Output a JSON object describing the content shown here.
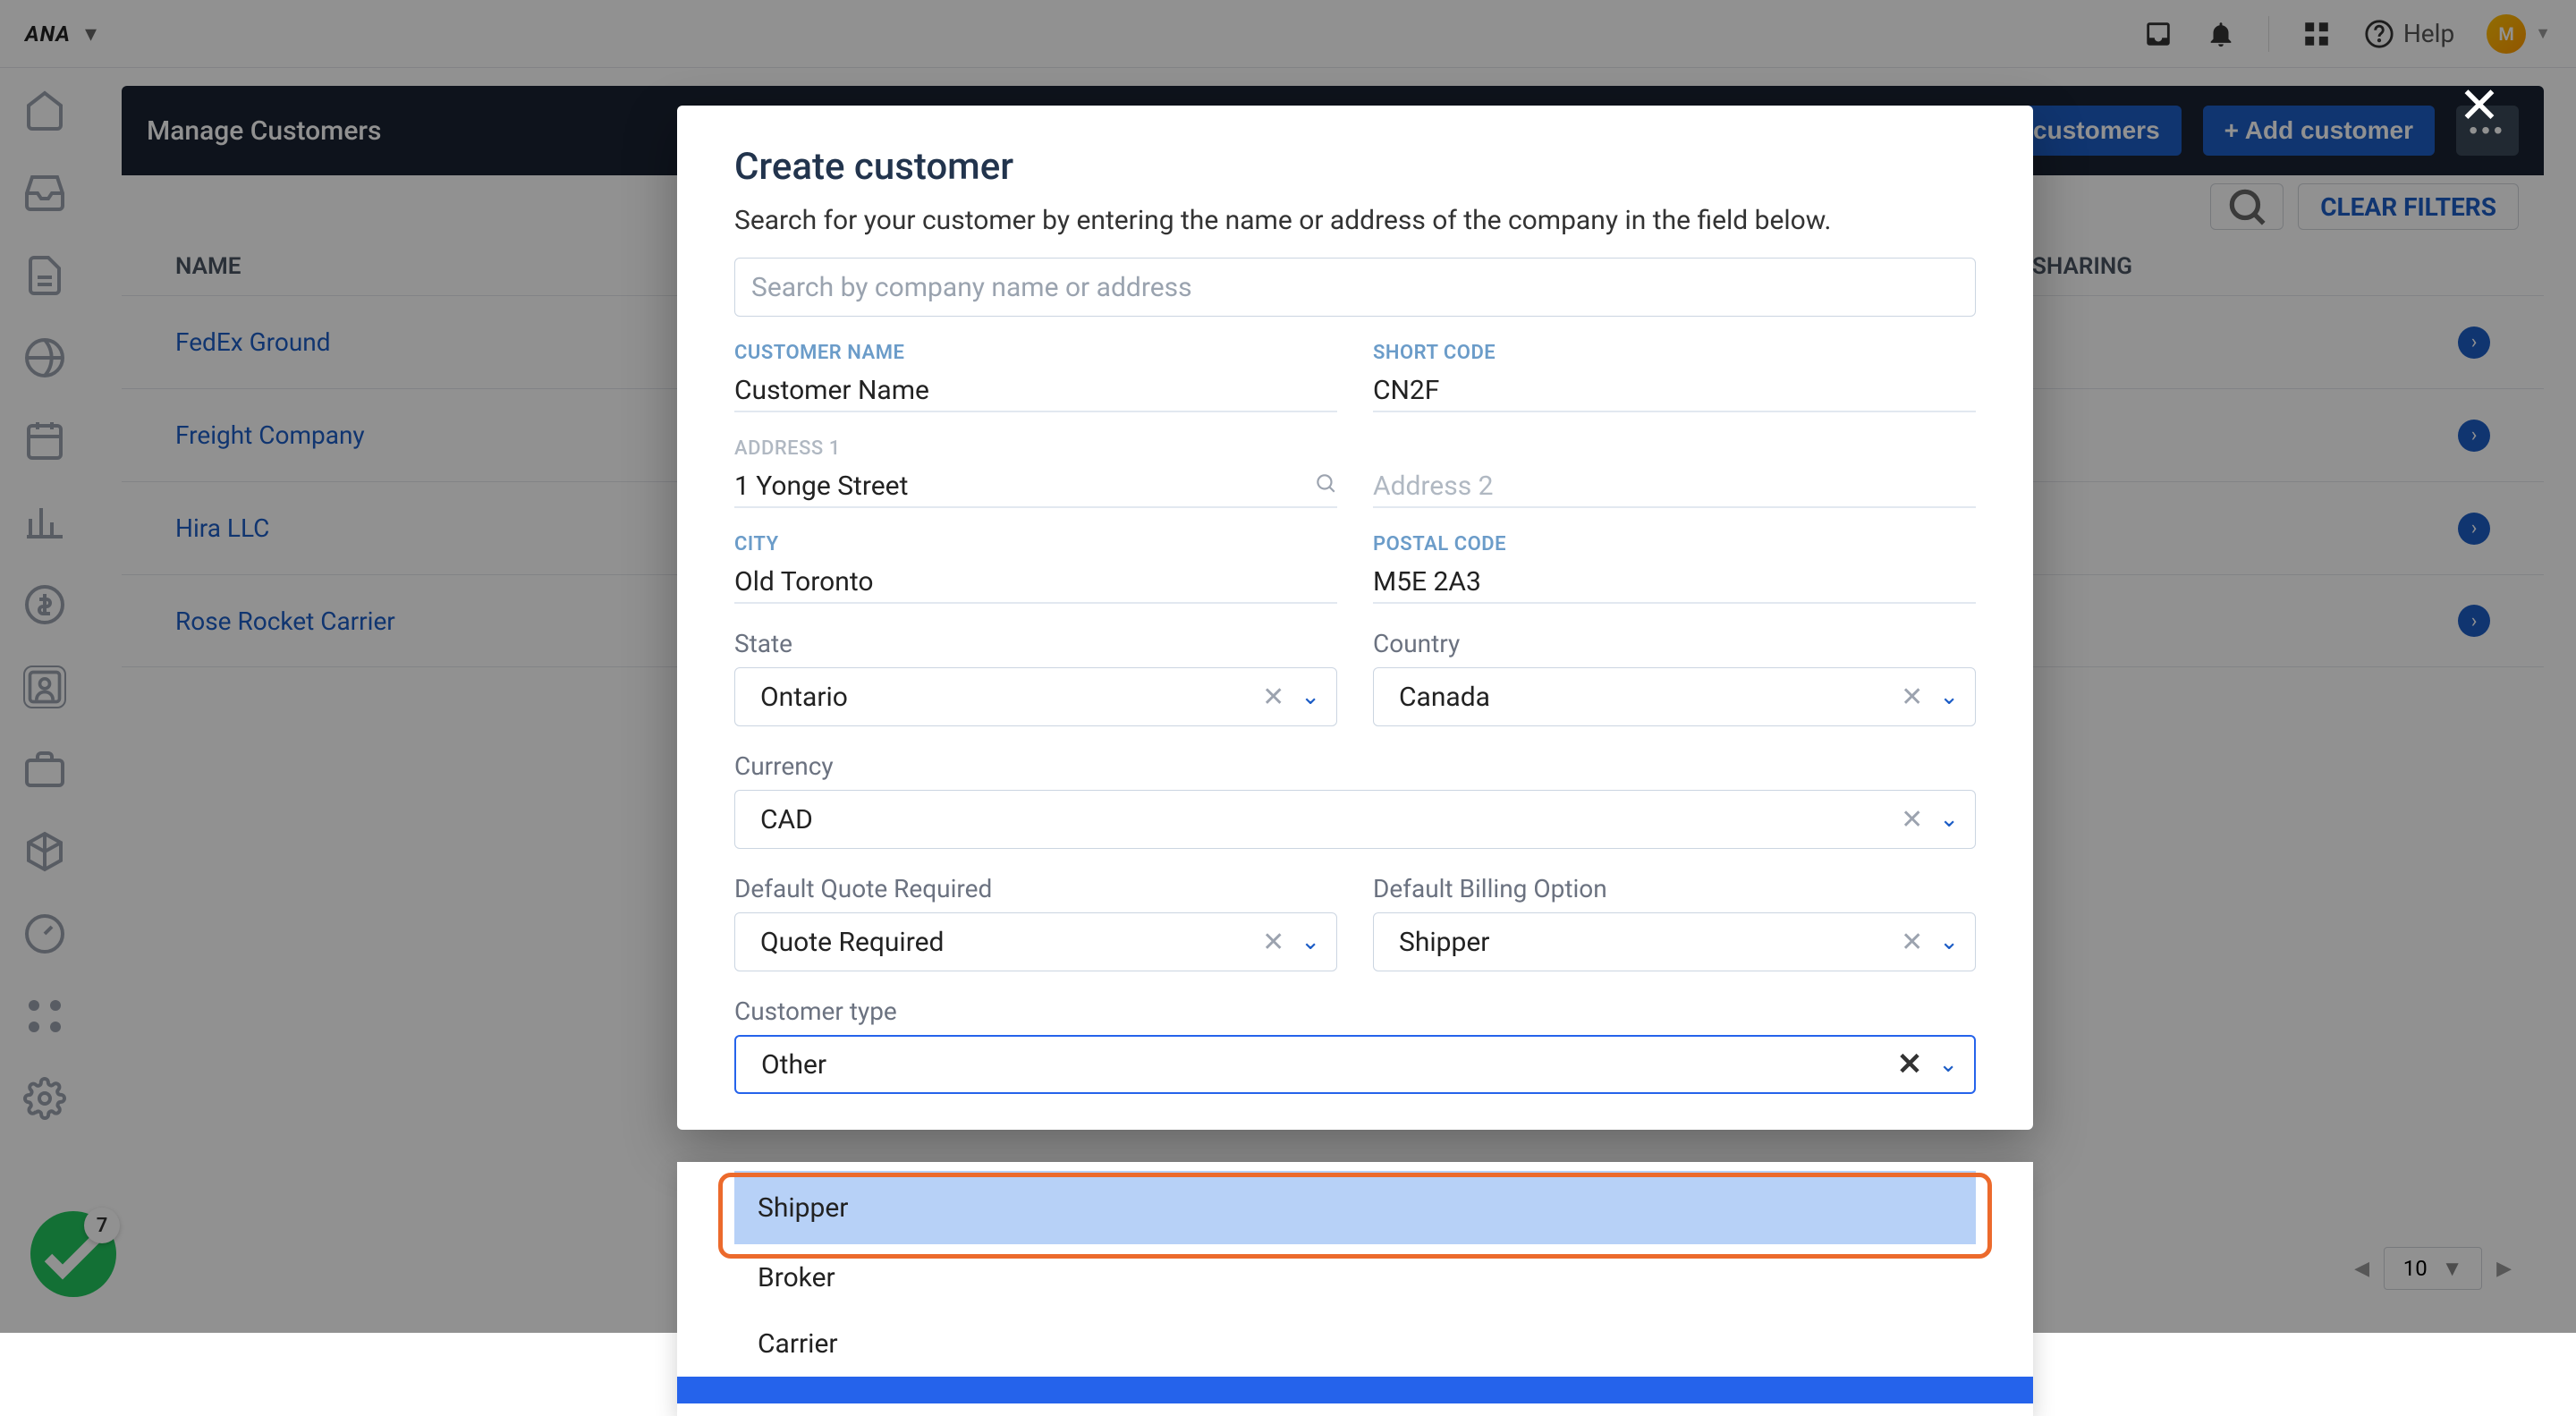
{
  "topbar": {
    "brand": "ANA",
    "help": "Help",
    "avatar": "M"
  },
  "header": {
    "title": "Manage Customers",
    "import": "Import customers",
    "add": "+ Add customer",
    "clear_filters": "CLEAR FILTERS"
  },
  "table": {
    "col_name": "NAME",
    "col_sharing": "NOTIFICATION SHARING",
    "rows": [
      {
        "name": "FedEx Ground"
      },
      {
        "name": "Freight Company"
      },
      {
        "name": "Hira LLC"
      },
      {
        "name": "Rose Rocket Carrier"
      }
    ]
  },
  "pager": {
    "value": "10"
  },
  "fab": {
    "badge": "7"
  },
  "modal": {
    "title": "Create customer",
    "subtitle": "Search for your customer by entering the name or address of the company in the field below.",
    "search_placeholder": "Search by company name or address",
    "labels": {
      "customer_name": "CUSTOMER NAME",
      "short_code": "SHORT CODE",
      "address1": "ADDRESS 1",
      "city": "CITY",
      "postal_code": "POSTAL CODE",
      "state": "State",
      "country": "Country",
      "currency": "Currency",
      "quote": "Default Quote Required",
      "billing": "Default Billing Option",
      "ctype": "Customer type"
    },
    "values": {
      "customer_name": "Customer Name",
      "short_code": "CN2F",
      "address1": "1 Yonge Street",
      "address2_placeholder": "Address 2",
      "city": "Old Toronto",
      "postal_code": "M5E 2A3",
      "state": "Ontario",
      "country": "Canada",
      "currency": "CAD",
      "quote": "Quote Required",
      "billing": "Shipper",
      "ctype": "Other"
    },
    "dropdown": {
      "opt1": "Shipper",
      "opt2": "Broker",
      "opt3": "Carrier"
    }
  }
}
